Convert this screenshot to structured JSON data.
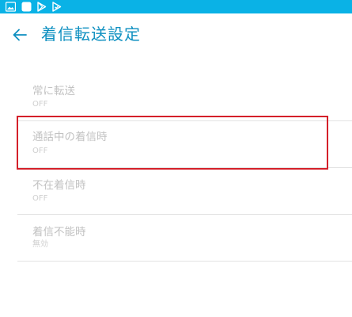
{
  "status_bar": {
    "color": "#0ab2e6",
    "icons": [
      "image-icon",
      "app-square-icon",
      "play-store-icon",
      "play-store-check-icon"
    ]
  },
  "header": {
    "title": "着信転送設定",
    "back_icon": "arrow-left-icon",
    "accent_color": "#0d8fc0"
  },
  "settings": [
    {
      "title": "常に転送",
      "summary": "OFF"
    },
    {
      "title": "通話中の着信時",
      "summary": "OFF"
    },
    {
      "title": "不在着信時",
      "summary": "OFF"
    },
    {
      "title": "着信不能時",
      "summary": "無効"
    }
  ],
  "highlight": {
    "target": "通話中の着信時",
    "color": "#d4202a"
  }
}
